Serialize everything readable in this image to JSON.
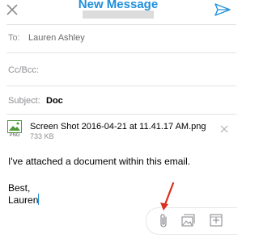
{
  "header": {
    "title": "New Message",
    "close_icon": "close-icon",
    "send_icon": "send-icon"
  },
  "fields": {
    "to_label": "To:",
    "to_value": "Lauren Ashley",
    "cc_label": "Cc/Bcc:",
    "subject_label": "Subject:",
    "subject_value": "Doc"
  },
  "attachment": {
    "filename": "Screen Shot 2016-04-21 at 11.41.17 AM.png",
    "size": "733 KB",
    "type_label": "PNG"
  },
  "body": {
    "line1": "I've attached a document within this email.",
    "line2": "Best,",
    "line3": "Lauren"
  },
  "toolbar": {
    "attach_icon": "paperclip-icon",
    "photos_icon": "photos-icon",
    "add_icon": "add-icon"
  },
  "colors": {
    "accent": "#1f8fdb",
    "annotation_arrow": "#d9301f"
  }
}
